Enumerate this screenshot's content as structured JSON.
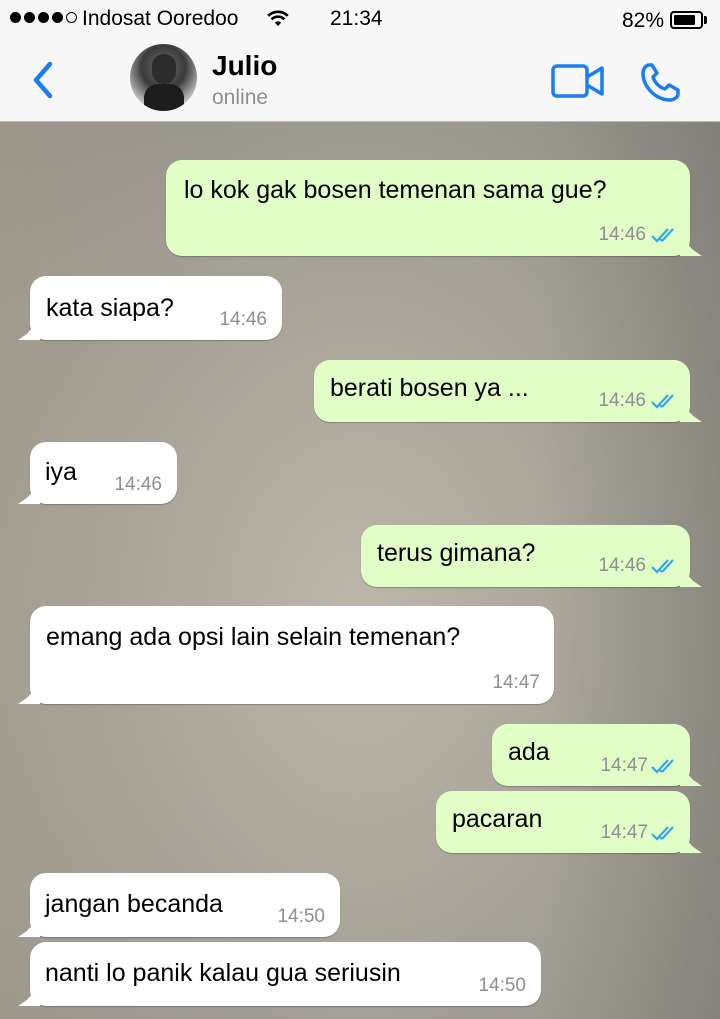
{
  "status_bar": {
    "carrier": "Indosat Ooredoo",
    "time": "21:34",
    "battery_percent": "82%",
    "battery_level": 0.82,
    "signal_bars": 4,
    "signal_total": 5
  },
  "header": {
    "contact_name": "Julio",
    "contact_status": "online",
    "back_icon": "chevron-left-icon",
    "video_icon": "video-camera-icon",
    "call_icon": "phone-icon"
  },
  "colors": {
    "accent": "#1a7df0",
    "outgoing_bubble": "#e1fec6",
    "incoming_bubble": "#ffffff",
    "read_ticks": "#34a7f0"
  },
  "messages": [
    {
      "direction": "out",
      "text": "lo kok gak bosen temenan sama gue?",
      "time": "14:46",
      "read": true
    },
    {
      "direction": "in",
      "text": "kata siapa?",
      "time": "14:46"
    },
    {
      "direction": "out",
      "text": "berati bosen ya ...",
      "time": "14:46",
      "read": true
    },
    {
      "direction": "in",
      "text": "iya",
      "time": "14:46"
    },
    {
      "direction": "out",
      "text": "terus gimana?",
      "time": "14:46",
      "read": true
    },
    {
      "direction": "in",
      "text": "emang ada opsi lain selain temenan?",
      "time": "14:47"
    },
    {
      "direction": "out",
      "text": "ada",
      "time": "14:47",
      "read": true
    },
    {
      "direction": "out",
      "text": "pacaran",
      "time": "14:47",
      "read": true
    },
    {
      "direction": "in",
      "text": "jangan becanda",
      "time": "14:50"
    },
    {
      "direction": "in",
      "text": "nanti lo panik kalau gua seriusin",
      "time": "14:50"
    }
  ]
}
